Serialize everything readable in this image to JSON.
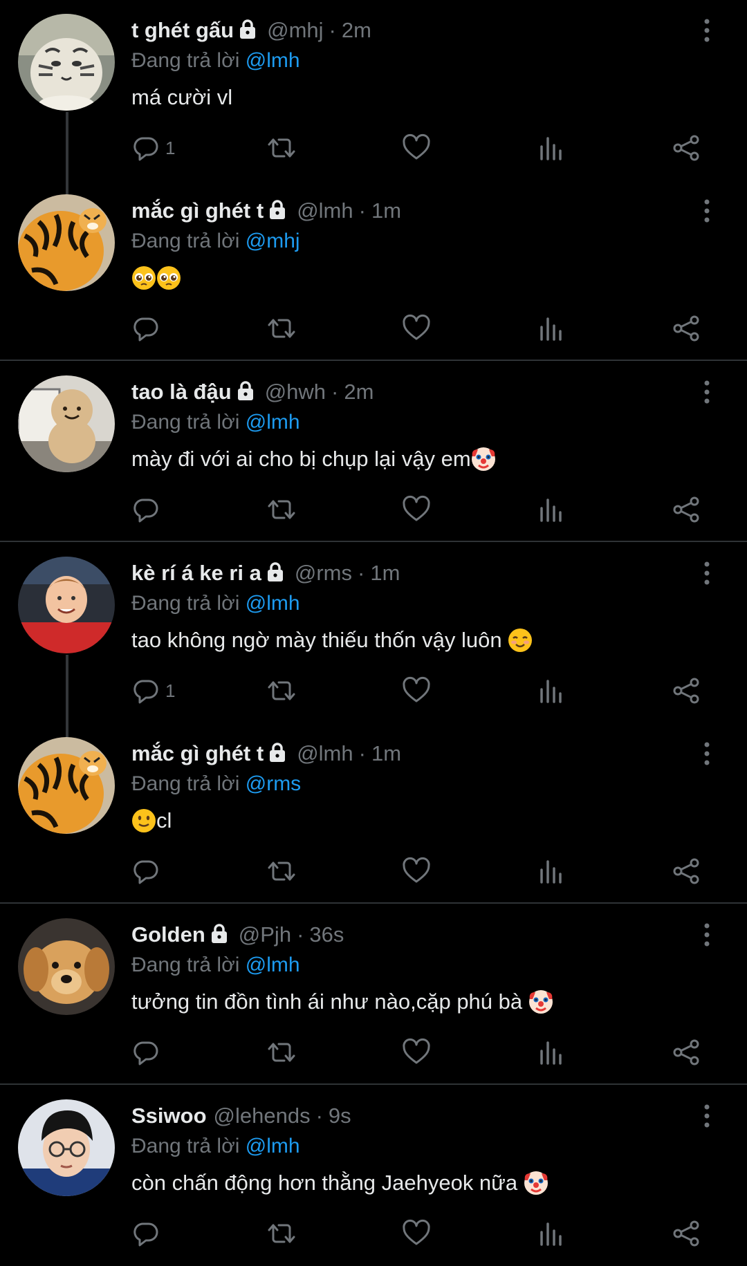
{
  "colors": {
    "background": "#000000",
    "text": "#e7e9ea",
    "muted": "#71767b",
    "link": "#1d9bf0",
    "divider": "#2f3336"
  },
  "reply_prefix": "Đang trả lời",
  "tweets": [
    {
      "name": "t ghét gấu",
      "locked": true,
      "handle": "@mhj",
      "time": "2m",
      "reply_to": "@lmh",
      "text": "má cười vl",
      "emoji": [],
      "reply_count": "1",
      "avatar": "white-tiger-figurine"
    },
    {
      "name": "mắc gì ghét t",
      "locked": true,
      "handle": "@lmh",
      "time": "1m",
      "reply_to": "@mhj",
      "text": "",
      "emoji": [
        "pleading-face-emoji",
        "pleading-face-emoji"
      ],
      "reply_count": "",
      "avatar": "orange-tiger-figurine"
    },
    {
      "name": "tao là đậu",
      "locked": true,
      "handle": "@hwh",
      "time": "2m",
      "reply_to": "@lmh",
      "text": "mày đi với ai cho bị chụp lại vậy em",
      "emoji": [
        "clown-face-emoji"
      ],
      "reply_count": "",
      "avatar": "peanut-plush"
    },
    {
      "name": "kè rí á ke ri a",
      "locked": true,
      "handle": "@rms",
      "time": "1m",
      "reply_to": "@lmh",
      "text": "tao không ngờ mày thiếu thốn vậy luôn ",
      "emoji": [
        "smiling-face-emoji"
      ],
      "reply_count": "1",
      "avatar": "smiling-kid"
    },
    {
      "name": "mắc gì ghét t",
      "locked": true,
      "handle": "@lmh",
      "time": "1m",
      "reply_to": "@rms",
      "text": "cl",
      "emoji_before": [
        "slightly-smiling-face-emoji"
      ],
      "emoji": [],
      "reply_count": "",
      "avatar": "orange-tiger-figurine"
    },
    {
      "name": "Golden",
      "locked": true,
      "handle": "@Pjh",
      "time": "36s",
      "reply_to": "@lmh",
      "text": "tưởng tin đồn tình ái như nào,cặp phú bà ",
      "emoji": [
        "clown-face-emoji"
      ],
      "reply_count": "",
      "avatar": "golden-retriever-puppy"
    },
    {
      "name": "Ssiwoo",
      "locked": false,
      "handle": "@lehends",
      "time": "9s",
      "reply_to": "@lmh",
      "text": "còn chấn động hơn thằng Jaehyeok nữa ",
      "emoji": [
        "clown-face-emoji"
      ],
      "reply_count": "",
      "avatar": "man-with-glasses"
    }
  ]
}
